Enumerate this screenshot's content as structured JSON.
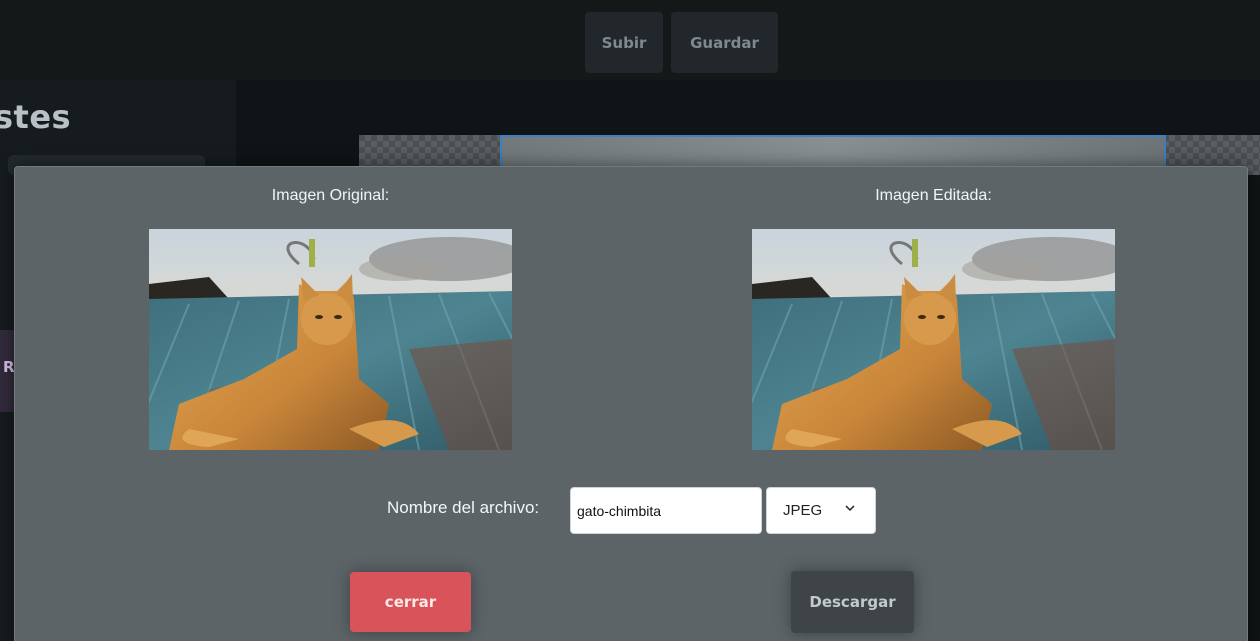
{
  "toolbar": {
    "upload_label": "Subir",
    "save_label": "Guardar"
  },
  "sidebar": {
    "title_fragment": "stes",
    "partial_letter": "R"
  },
  "modal": {
    "original_label": "Imagen Original:",
    "edited_label": "Imagen Editada:",
    "filename_label": "Nombre del archivo:",
    "filename_value": "gato-chimbita",
    "format_selected": "JPEG",
    "format_options": [
      "JPEG"
    ],
    "close_label": "cerrar",
    "download_label": "Descargar"
  },
  "colors": {
    "modal_bg": "#5c6467",
    "close_button": "#d9535a",
    "download_button": "#3e4447",
    "page_bg": "#0f1416",
    "selection_outline": "#3d7fc4"
  },
  "icons": {
    "format_dropdown": "chevron-down-icon"
  }
}
